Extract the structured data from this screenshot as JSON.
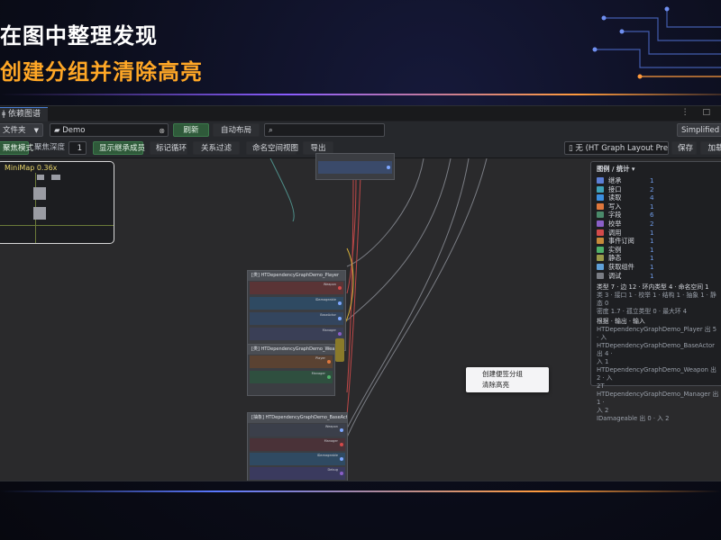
{
  "slide": {
    "title_line1": "在图中整理发现",
    "title_line2": "创建分组并清除高亮"
  },
  "app": {
    "tab_label": "依赖图谱",
    "window_controls": "⋮ □",
    "toolbar1": {
      "folder_select": "文件夹",
      "search_root": "Demo",
      "refresh": "刷新",
      "auto_layout": "自动布局",
      "search_placeholder": "",
      "mode_select": "Simplified C"
    },
    "toolbar2": {
      "focus_mode": "聚焦模式",
      "focus_depth_label": "聚焦深度",
      "focus_depth_value": "1",
      "show_inherited": "显示继承成员",
      "mark_cycles": "标记循环",
      "relation_filter": "关系过滤",
      "namespace_view": "命名空间视图",
      "export": "导出",
      "layout_select": "无 (HT Graph Layout Pre",
      "save": "保存",
      "load": "加载"
    },
    "minimap": {
      "label": "MiniMap  0.36x"
    },
    "nodes": [
      {
        "title": "[类] HTDependencyGraphDemo_Player"
      },
      {
        "title": "[类] HTDependencyGraphDemo_Weapon"
      },
      {
        "title": "[抽象] HTDependencyGraphDemo_BaseActor"
      }
    ],
    "legend": {
      "title": "图例 / 统计 ▾",
      "items": [
        {
          "label": "继承",
          "count": "1",
          "color": "#5d7fd6"
        },
        {
          "label": "接口",
          "count": "2",
          "color": "#3fa2b8"
        },
        {
          "label": "读取",
          "count": "4",
          "color": "#3c8fe0"
        },
        {
          "label": "写入",
          "count": "1",
          "color": "#e0773c"
        },
        {
          "label": "字段",
          "count": "6",
          "color": "#4a8a6a"
        },
        {
          "label": "校举",
          "count": "2",
          "color": "#8a5fc7"
        },
        {
          "label": "调用",
          "count": "1",
          "color": "#d34a4a"
        },
        {
          "label": "事件订阅",
          "count": "1",
          "color": "#c78a3a"
        },
        {
          "label": "实例",
          "count": "1",
          "color": "#4fb06a"
        },
        {
          "label": "静态",
          "count": "1",
          "color": "#9a9a4a"
        },
        {
          "label": "获取组件",
          "count": "1",
          "color": "#5fa0d8"
        },
        {
          "label": "调试",
          "count": "1",
          "color": "#7a7d84"
        }
      ],
      "stats_lines": [
        "类型 7 · 边 12 · 环内类型 4 · 命名空间 1",
        "类 3 · 接口 1 · 校举 1 · 结构 1 · 抽象 1 · 静态 0",
        "密度 1.7 · 孤立类型 0 · 最大环 4"
      ],
      "fan_title": "根据 · 输出 · 输入",
      "fan_lines": [
        "HTDependencyGraphDemo_Player  出 5 · 入",
        "HTDependencyGraphDemo_BaseActor  出 4 ·",
        "入 1",
        "HTDependencyGraphDemo_Weapon  出 2 · 入",
        "2T",
        "HTDependencyGraphDemo_Manager  出 1 ·",
        "入 2",
        "IDamageable  出 0 · 入 2"
      ]
    },
    "context_menu": {
      "items": [
        "创建便签分组",
        "清除高亮"
      ]
    }
  }
}
